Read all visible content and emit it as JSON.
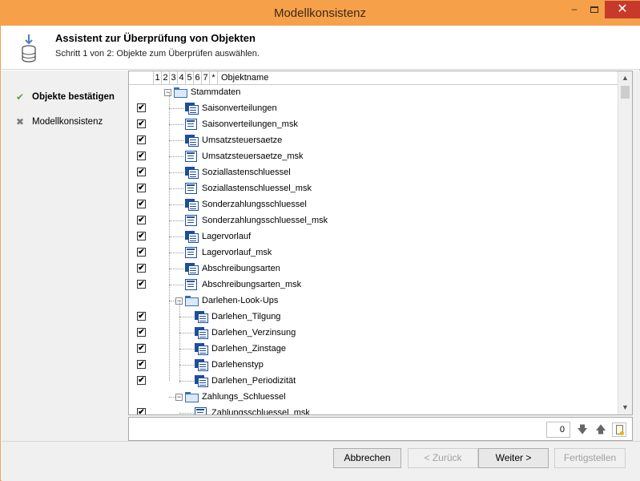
{
  "window": {
    "title": "Modellkonsistenz"
  },
  "header": {
    "title": "Assistent zur Überprüfung von Objekten",
    "subtitle": "Schritt 1 von 2: Objekte zum Überprüfen auswählen."
  },
  "steps": [
    {
      "label": "Objekte bestätigen",
      "state": "done",
      "icon": "checkmark-icon"
    },
    {
      "label": "Modellkonsistenz",
      "state": "pending",
      "icon": "x-icon"
    }
  ],
  "grid": {
    "columns": [
      "1",
      "2",
      "3",
      "4",
      "5",
      "6",
      "7",
      "*",
      "Objektname"
    ],
    "rows": [
      {
        "type": "folder",
        "name": "Stammdaten",
        "expanded": true,
        "checked": null
      },
      {
        "type": "table",
        "name": "Saisonverteilungen",
        "checked": true
      },
      {
        "type": "mask",
        "name": "Saisonverteilungen_msk",
        "checked": true
      },
      {
        "type": "table",
        "name": "Umsatzsteuersaetze",
        "checked": true
      },
      {
        "type": "mask",
        "name": "Umsatzsteuersaetze_msk",
        "checked": true
      },
      {
        "type": "table",
        "name": "Soziallastenschluessel",
        "checked": true
      },
      {
        "type": "mask",
        "name": "Soziallastenschluessel_msk",
        "checked": true
      },
      {
        "type": "table",
        "name": "Sonderzahlungsschluessel",
        "checked": true
      },
      {
        "type": "mask",
        "name": "Sonderzahlungsschluessel_msk",
        "checked": true
      },
      {
        "type": "table",
        "name": "Lagervorlauf",
        "checked": true
      },
      {
        "type": "mask",
        "name": "Lagervorlauf_msk",
        "checked": true
      },
      {
        "type": "table",
        "name": "Abschreibungsarten",
        "checked": true
      },
      {
        "type": "mask",
        "name": "Abschreibungsarten_msk",
        "checked": true
      },
      {
        "type": "subfolder",
        "name": "Darlehen-Look-Ups",
        "expanded": true,
        "checked": null
      },
      {
        "type": "subtable",
        "name": "Darlehen_Tilgung",
        "checked": true
      },
      {
        "type": "subtable",
        "name": "Darlehen_Verzinsung",
        "checked": true
      },
      {
        "type": "subtable",
        "name": "Darlehen_Zinstage",
        "checked": true
      },
      {
        "type": "subtable",
        "name": "Darlehenstyp",
        "checked": true
      },
      {
        "type": "subtable",
        "name": "Darlehen_Periodizität",
        "checked": true
      },
      {
        "type": "subfolder",
        "name": "Zahlungs_Schluessel",
        "expanded": true,
        "checked": null
      },
      {
        "type": "submask",
        "name": "Zahlungsschluessel_msk",
        "checked": true
      }
    ]
  },
  "footer": {
    "count": "0"
  },
  "buttons": {
    "cancel": "Abbrechen",
    "back": "< Zurück",
    "next": "Weiter >",
    "finish": "Fertigstellen"
  },
  "colors": {
    "titlebar": "#f6a04a",
    "close": "#c7392b",
    "icon_blue": "#1f4e99",
    "check_green": "#64a13a"
  }
}
